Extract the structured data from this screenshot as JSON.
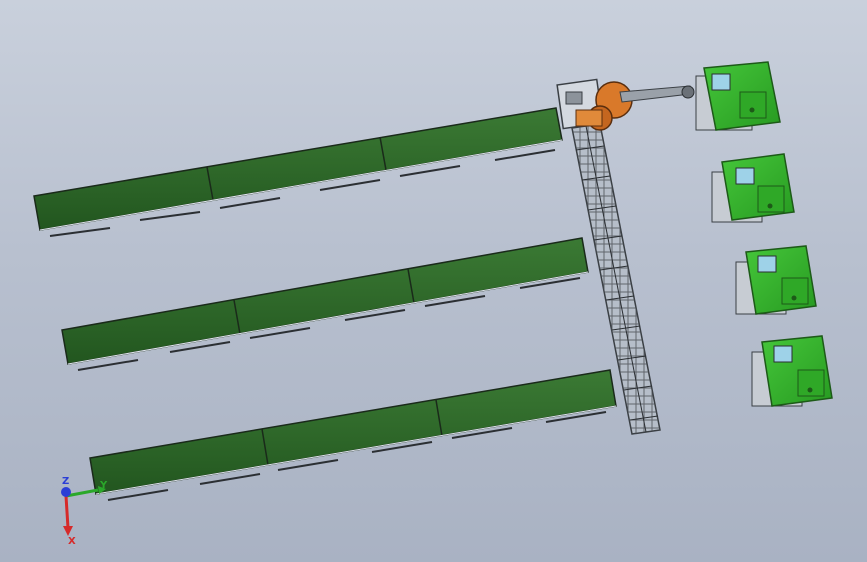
{
  "colors": {
    "background_top": "#c9d0dc",
    "background_bottom": "#a9b2c3",
    "conveyor_top": "#2f6a2f",
    "conveyor_side": "#1e4f1e",
    "frame": "#3a3f44",
    "machine_green": "#35b52a",
    "machine_dark": "#2a7d25",
    "robot_orange": "#d9792a",
    "axis_x": "#d62a2a",
    "axis_y": "#2aa82a",
    "axis_z": "#2a3ed6"
  },
  "triad": {
    "x_label": "X",
    "y_label": "Y",
    "z_label": "Z"
  }
}
